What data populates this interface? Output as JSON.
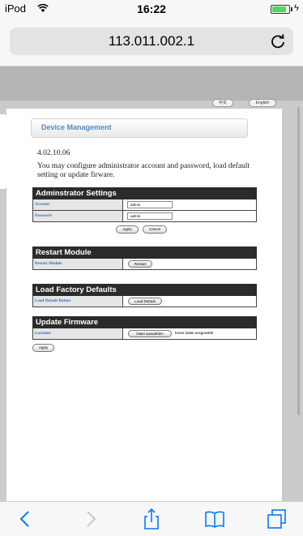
{
  "status_bar": {
    "carrier": "iPod",
    "time": "16:22",
    "battery_level": 0.85
  },
  "browser": {
    "url": "113.011.002.1"
  },
  "page": {
    "lang_buttons": {
      "chinese": "中文",
      "english": "English"
    },
    "header_title": "Device Management",
    "version": "4.02.10.06",
    "description": "You may configure administrator account and password, load default setting or update firware.",
    "admin": {
      "title": "Adminstrator Settings",
      "account_label": "Account",
      "account_value": "admin",
      "password_label": "Password",
      "password_value": "admin",
      "apply_label": "Apply",
      "cancel_label": "Cancel"
    },
    "restart": {
      "title": "Restart Module",
      "row_label": "Restart Module",
      "button_label": "Restart"
    },
    "factory": {
      "title": "Load Factory Defaults",
      "row_label": "Load Default Button",
      "button_label": "Load Default"
    },
    "firmware": {
      "title": "Update Firmware",
      "row_label": "Location:",
      "choose_label": "Datei auswählen",
      "no_file_text": "Keine Datei ausgewählt",
      "apply_label": "Apply"
    }
  },
  "toolbar_icons": [
    "back-icon",
    "forward-icon",
    "share-icon",
    "bookmarks-icon",
    "tabs-icon"
  ],
  "colors": {
    "link_blue": "#3d6fb0",
    "header_blue": "#4f8bc8",
    "section_dark": "#2b2b2b",
    "ios_blue": "#007aff",
    "battery_green": "#4cd964"
  }
}
